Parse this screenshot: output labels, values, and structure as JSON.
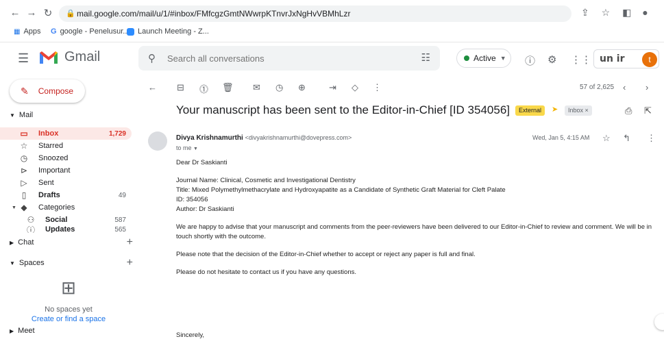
{
  "browser": {
    "url": "mail.google.com/mail/u/1/#inbox/FMfcgzGmtNWwrpKTnvrJxNgHvVBMhLzr",
    "bookmarks": [
      {
        "label": "Apps"
      },
      {
        "label": "google - Penelusur..."
      },
      {
        "label": "Launch Meeting - Z..."
      }
    ]
  },
  "header": {
    "app_name": "Gmail",
    "search_placeholder": "Search all conversations",
    "status_label": "Active",
    "brand_text": "un ir",
    "avatar_letter": "t"
  },
  "sidebar": {
    "compose_label": "Compose",
    "mail_section": "Mail",
    "items": [
      {
        "label": "Inbox",
        "count": "1,729"
      },
      {
        "label": "Starred",
        "count": ""
      },
      {
        "label": "Snoozed",
        "count": ""
      },
      {
        "label": "Important",
        "count": ""
      },
      {
        "label": "Sent",
        "count": ""
      },
      {
        "label": "Drafts",
        "count": "49"
      },
      {
        "label": "Categories",
        "count": ""
      },
      {
        "label": "Social",
        "count": "587"
      },
      {
        "label": "Updates",
        "count": "565"
      }
    ],
    "chat_section": "Chat",
    "spaces_section": "Spaces",
    "spaces_empty": "No spaces yet",
    "spaces_link": "Create or find a space",
    "meet_section": "Meet"
  },
  "toolbar": {
    "pager": "57 of 2,625"
  },
  "email": {
    "subject": "Your manuscript has been sent to the Editor-in-Chief [ID 354056]",
    "tag_external": "External",
    "tag_inbox": "Inbox ×",
    "sender_name": "Divya Krishnamurthi",
    "sender_email": "<divyakrishnamurthi@dovepress.com>",
    "to": "to me",
    "date": "Wed, Jan 5, 4:15 AM",
    "greeting": "Dear Dr Saskianti",
    "journal": "Journal Name: Clinical, Cosmetic and Investigational Dentistry",
    "title": "Title: Mixed Polymethylmethacrylate and Hydroxyapatite as a Candidate of Synthetic Graft Material for Cleft Palate",
    "id": "ID: 354056",
    "author": "Author: Dr Saskianti",
    "para1": "We are happy to advise that your manuscript and comments from the peer-reviewers have been delivered to our Editor-in-Chief to review and comment. We will be in touch shortly with the outcome.",
    "para2": "Please note that the decision of the Editor-in-Chief whether to accept or reject any paper is full and final.",
    "para3": "Please do not hesitate to contact us if you have any questions.",
    "closing": "Sincerely,"
  }
}
